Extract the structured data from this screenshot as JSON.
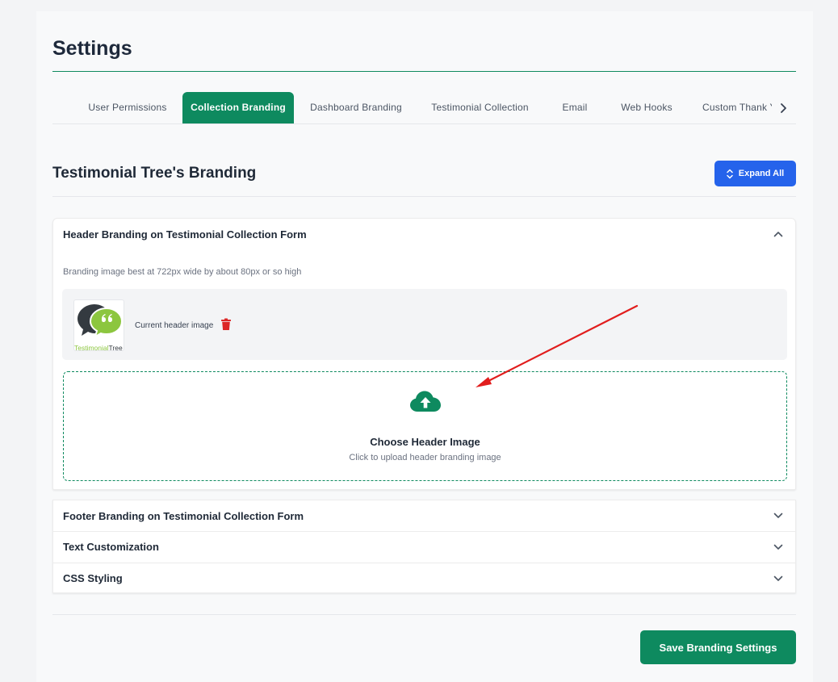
{
  "page": {
    "title": "Settings"
  },
  "tabs": [
    {
      "label": "User Permissions",
      "active": false
    },
    {
      "label": "Collection Branding",
      "active": true
    },
    {
      "label": "Dashboard Branding",
      "active": false
    },
    {
      "label": "Testimonial Collection",
      "active": false
    },
    {
      "label": "Email",
      "active": false
    },
    {
      "label": "Web Hooks",
      "active": false
    },
    {
      "label": "Custom Thank Y",
      "active": false
    }
  ],
  "section": {
    "title": "Testimonial Tree's Branding",
    "expand_all_label": "Expand All"
  },
  "header_branding": {
    "title": "Header Branding on Testimonial Collection Form",
    "hint": "Branding image best at 722px wide by about 80px or so high",
    "current_label": "Current header image",
    "logo_text_a": "Testimonial",
    "logo_text_b": "Tree",
    "dropzone_title": "Choose Header Image",
    "dropzone_subtitle": "Click to upload header branding image"
  },
  "collapsed_sections": [
    {
      "title": "Footer Branding on Testimonial Collection Form"
    },
    {
      "title": "Text Customization"
    },
    {
      "title": "CSS Styling"
    }
  ],
  "footer": {
    "save_label": "Save Branding Settings"
  },
  "colors": {
    "brand_green": "#0e8a5f",
    "primary_blue": "#2563eb",
    "danger_red": "#dc2626",
    "annotation_arrow": "#e11d1d"
  }
}
